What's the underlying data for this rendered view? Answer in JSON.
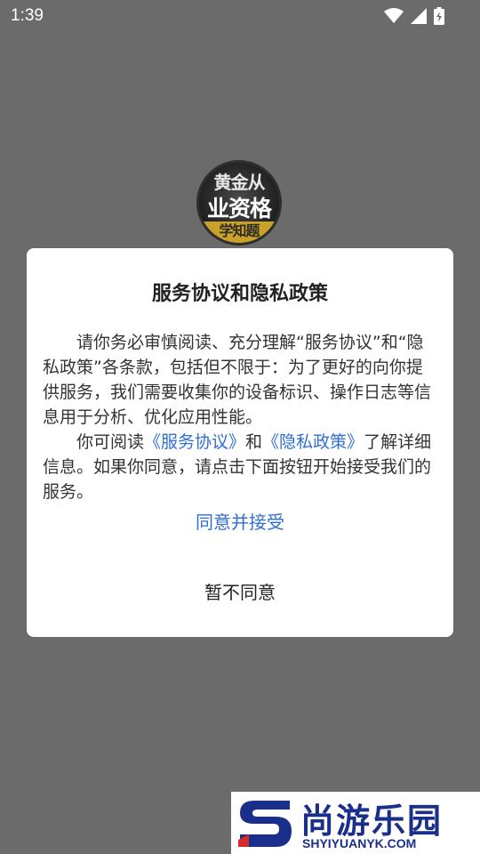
{
  "status_bar": {
    "time": "1:39",
    "icons": [
      "wifi-icon",
      "signal-icon",
      "battery-charging-icon"
    ]
  },
  "app_logo": {
    "line1": "黄金从",
    "line2": "业资格",
    "line3": "学知题"
  },
  "dialog": {
    "title": "服务协议和隐私政策",
    "paragraph1": "请你务必审慎阅读、充分理解“服务协议”和“隐私政策”各条款，包括但不限于：为了更好的向你提供服务，我们需要收集你的设备标识、操作日志等信息用于分析、优化应用性能。",
    "paragraph2_prefix": "你可阅读",
    "service_link": "《服务协议》",
    "and_text": "和",
    "privacy_link": "《隐私政策》",
    "paragraph2_suffix": "了解详细信息。如果你同意，请点击下面按钮开始接受我们的服务。",
    "accept_label": "同意并接受",
    "decline_label": "暂不同意"
  },
  "watermark": {
    "title": "尚游乐园",
    "url": "SHYIYUANYK.COM"
  },
  "colors": {
    "overlay": "#6b6b6b",
    "link": "#2f6fd6",
    "watermark": "#1a2f8a"
  }
}
